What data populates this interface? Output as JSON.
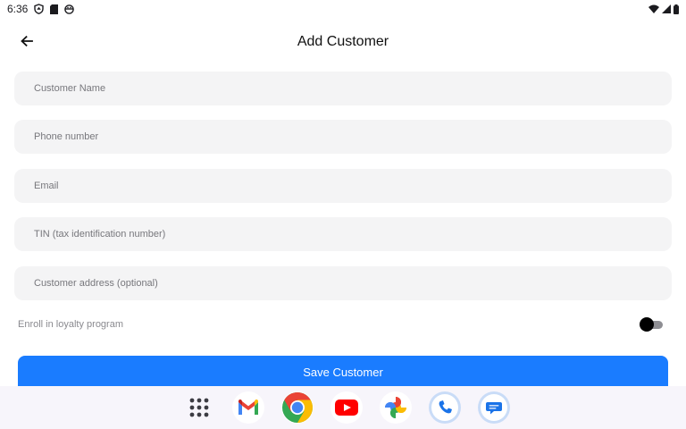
{
  "status_bar": {
    "time": "6:36",
    "left_icons": [
      "shield-icon",
      "sim-icon",
      "face-icon"
    ],
    "right_icons": [
      "wifi-icon",
      "signal-icon",
      "battery-icon"
    ]
  },
  "header": {
    "back_icon": "arrow-left-icon",
    "title": "Add Customer"
  },
  "form": {
    "fields": [
      {
        "name": "customer-name-field",
        "placeholder": "Customer Name",
        "value": ""
      },
      {
        "name": "phone-number-field",
        "placeholder": "Phone number",
        "value": ""
      },
      {
        "name": "email-field",
        "placeholder": "Email",
        "value": ""
      },
      {
        "name": "tin-field",
        "placeholder": "TIN (tax identification number)",
        "value": ""
      },
      {
        "name": "customer-address-field",
        "placeholder": "Customer address (optional)",
        "value": ""
      }
    ],
    "loyalty": {
      "label": "Enroll in loyalty program",
      "enabled": false
    },
    "save_button": {
      "label": "Save Customer"
    }
  },
  "dock": {
    "apps": [
      "app-drawer-icon",
      "gmail-icon",
      "chrome-icon",
      "youtube-icon",
      "photos-icon",
      "phone-icon",
      "messages-icon"
    ]
  },
  "colors": {
    "accent": "#1a7cff",
    "field_bg": "#f4f4f5",
    "dock_bg": "#f7f5fb"
  }
}
